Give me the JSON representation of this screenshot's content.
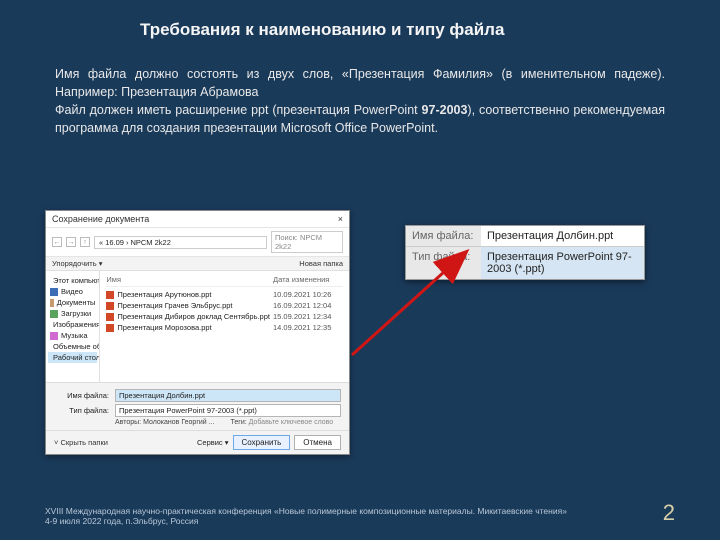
{
  "slide": {
    "title": "Требования к наименованию и типу файла",
    "body_line1": "Имя файла должно состоять из двух слов, «Презентация Фамилия» (в именительном падеже). Например:      Презентация Абрамова",
    "body_line2a": "Файл должен иметь расширение ppt (презентация PowerPoint ",
    "body_line2_bold": "97-2003",
    "body_line2b": "), соответственно рекомендуемая программа для создания презентации Microsoft Office PowerPoint."
  },
  "dialog": {
    "title": "Сохранение документа",
    "close": "×",
    "nav_back": "←",
    "nav_fwd": "→",
    "nav_up": "↑",
    "crumb_sep": "›",
    "crumb1": "16.09",
    "crumb2": "NPCM 2k22",
    "search_placeholder": "Поиск: NPCM 2k22",
    "organize": "Упорядочить ▾",
    "new_folder": "Новая папка",
    "nav_items": [
      {
        "icon": "i-pc",
        "label": "Этот компьютер"
      },
      {
        "icon": "i-vid",
        "label": "Видео"
      },
      {
        "icon": "i-doc",
        "label": "Документы"
      },
      {
        "icon": "i-dl",
        "label": "Загрузки"
      },
      {
        "icon": "i-img",
        "label": "Изображения"
      },
      {
        "icon": "i-mus",
        "label": "Музыка"
      },
      {
        "icon": "i-3d",
        "label": "Объемные объ"
      },
      {
        "icon": "i-desk",
        "label": "Рабочий стол"
      }
    ],
    "col_name": "Имя",
    "col_date": "Дата изменения",
    "files": [
      {
        "name": "Презентация Арутюнов.ppt",
        "date": "10.09.2021 10:26"
      },
      {
        "name": "Презентация Грачев Эльбрус.ppt",
        "date": "16.09.2021 12:04"
      },
      {
        "name": "Презентация Дибиров доклад Сентябрь.ppt",
        "date": "15.09.2021 12:34"
      },
      {
        "name": "Презентация Морозова.ppt",
        "date": "14.09.2021 12:35"
      }
    ],
    "lbl_filename": "Имя файла:",
    "val_filename": "Презентация Долбин.ppt",
    "lbl_filetype": "Тип файла:",
    "val_filetype": "Презентация PowerPoint 97-2003 (*.ppt)",
    "meta_authors_lbl": "Авторы:",
    "meta_authors_val": "Молоканов Георгий ...",
    "meta_tags_lbl": "Теги:",
    "meta_tags_val": "Добавьте ключевое слово",
    "hide_folders": "Скрыть папки",
    "tools": "Сервис ▾",
    "save": "Сохранить",
    "cancel": "Отмена"
  },
  "zoom": {
    "lbl_name": "Имя файла:",
    "val_name": "Презентация Долбин.ppt",
    "lbl_type": "Тип файла:",
    "val_type": "Презентация PowerPoint 97-2003 (*.ppt)"
  },
  "footer": {
    "line1": "XVIII Международная научно-практическая конференция «Новые полимерные композиционные материалы. Микитаевские чтения»",
    "line2": "4-9 июля 2022 года, п.Эльбрус, Россия",
    "page": "2"
  }
}
